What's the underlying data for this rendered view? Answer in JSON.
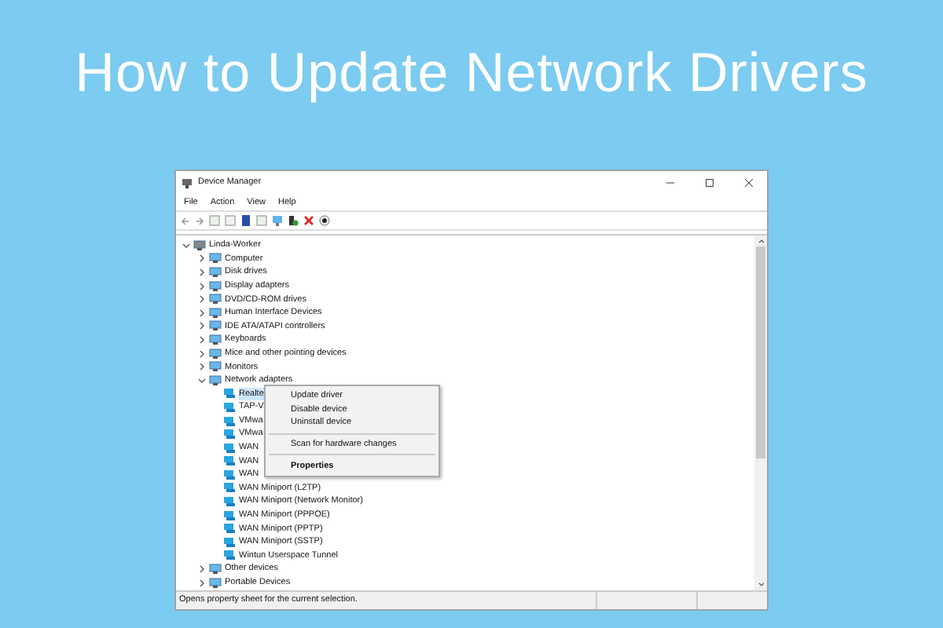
{
  "headline": "How to Update Network Drivers",
  "window": {
    "title": "Device Manager"
  },
  "menu_bar": [
    "File",
    "Action",
    "View",
    "Help"
  ],
  "tree": {
    "label": "Linda-Worker",
    "expanded": true,
    "children": [
      {
        "label": "Computer",
        "expanded": false
      },
      {
        "label": "Disk drives",
        "expanded": false
      },
      {
        "label": "Display adapters",
        "expanded": false
      },
      {
        "label": "DVD/CD-ROM drives",
        "expanded": false
      },
      {
        "label": "Human Interface Devices",
        "expanded": false
      },
      {
        "label": "IDE ATA/ATAPI controllers",
        "expanded": false
      },
      {
        "label": "Keyboards",
        "expanded": false
      },
      {
        "label": "Mice and other pointing devices",
        "expanded": false
      },
      {
        "label": "Monitors",
        "expanded": false
      },
      {
        "label": "Network adapters",
        "expanded": true,
        "children": [
          {
            "label": "Realte",
            "selected": true
          },
          {
            "label": "TAP-V",
            "selected": false
          },
          {
            "label": "VMwa",
            "selected": false
          },
          {
            "label": "VMwa",
            "selected": false
          },
          {
            "label": "WAN",
            "selected": false
          },
          {
            "label": "WAN",
            "selected": false
          },
          {
            "label": "WAN",
            "selected": false
          },
          {
            "label": "WAN Miniport (L2TP)",
            "selected": false
          },
          {
            "label": "WAN Miniport (Network Monitor)",
            "selected": false
          },
          {
            "label": "WAN Miniport (PPPOE)",
            "selected": false
          },
          {
            "label": "WAN Miniport (PPTP)",
            "selected": false
          },
          {
            "label": "WAN Miniport (SSTP)",
            "selected": false
          },
          {
            "label": "Wintun Userspace Tunnel",
            "selected": false
          }
        ]
      },
      {
        "label": "Other devices",
        "expanded": false
      },
      {
        "label": "Portable Devices",
        "expanded": false
      }
    ]
  },
  "context_menu": [
    {
      "kind": "item",
      "label": "Update driver"
    },
    {
      "kind": "item",
      "label": "Disable device"
    },
    {
      "kind": "item",
      "label": "Uninstall device"
    },
    {
      "kind": "separator"
    },
    {
      "kind": "item",
      "label": "Scan for hardware changes"
    },
    {
      "kind": "separator"
    },
    {
      "kind": "default",
      "label": "Properties"
    }
  ],
  "status_bar": "Opens property sheet for the current selection."
}
